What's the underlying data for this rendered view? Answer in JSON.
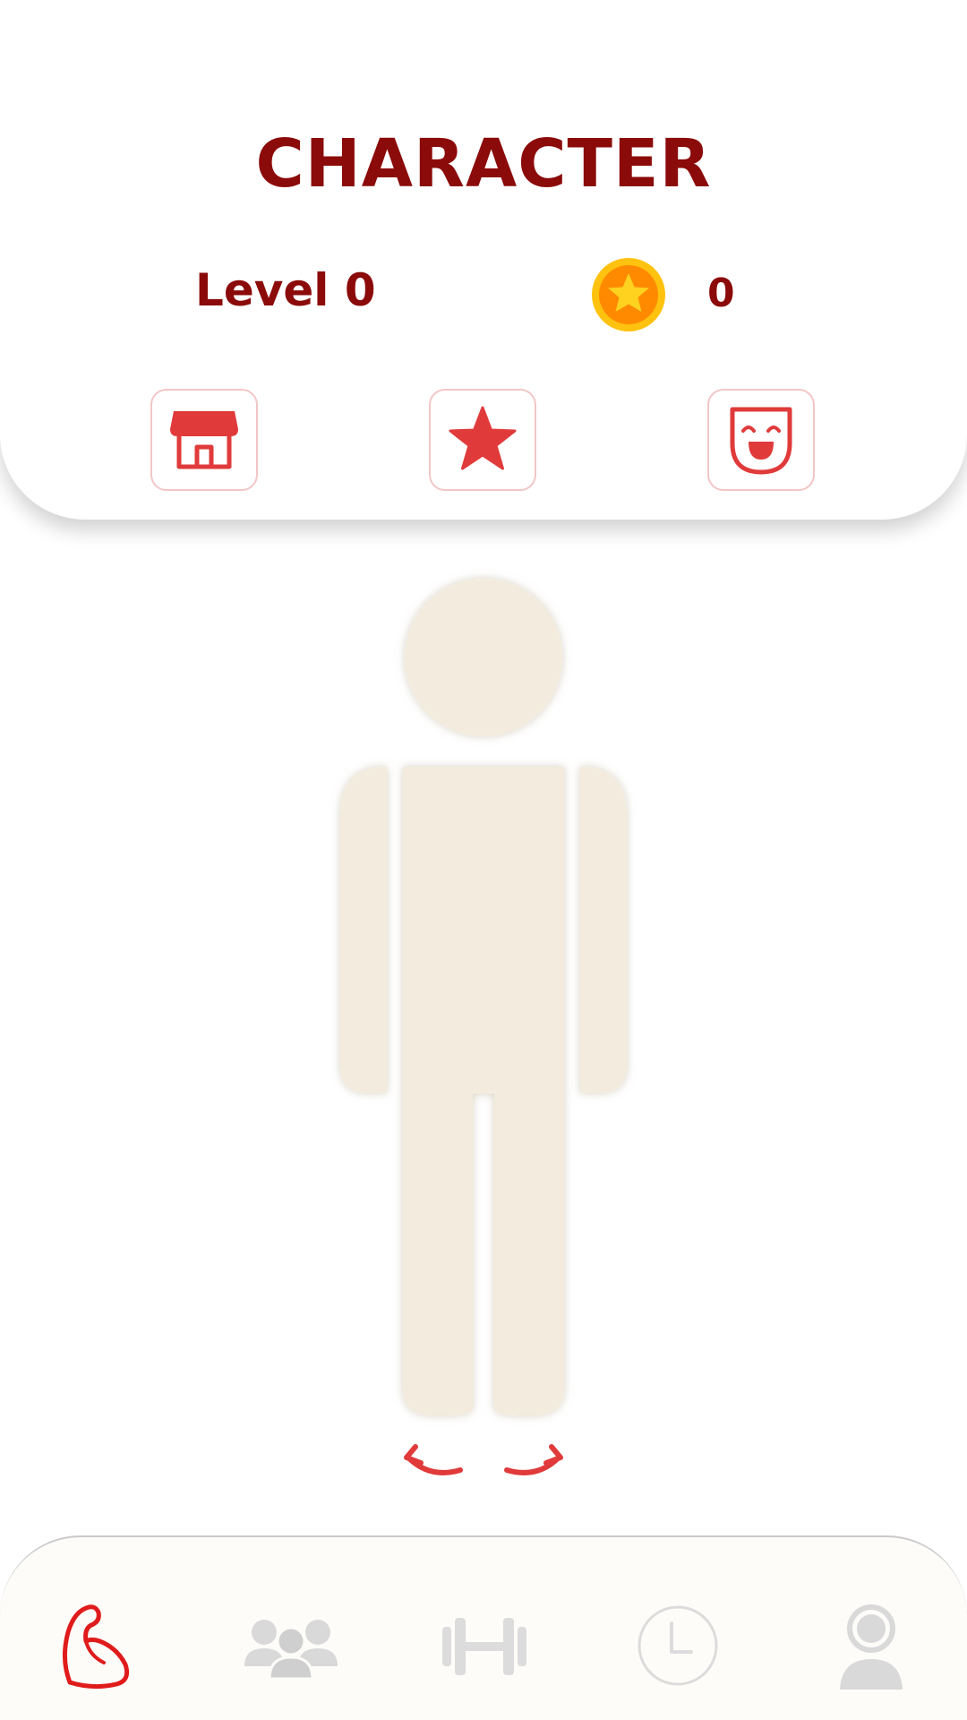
{
  "header": {
    "title": "CHARACTER",
    "level_text": "Level 0",
    "coin_count": "0",
    "coin_icon": "star-coin-icon"
  },
  "actions": [
    {
      "name": "shop",
      "icon": "store-icon"
    },
    {
      "name": "achievements",
      "icon": "star-icon"
    },
    {
      "name": "emotes",
      "icon": "smiley-face-icon"
    }
  ],
  "character": {
    "rotate_left_icon": "rotate-left-arrow-icon",
    "rotate_right_icon": "rotate-right-arrow-icon"
  },
  "bottom_nav": {
    "items": [
      {
        "name": "character",
        "icon": "flexed-arm-icon",
        "active": true
      },
      {
        "name": "friends",
        "icon": "group-icon",
        "active": false
      },
      {
        "name": "workout",
        "icon": "dumbbell-icon",
        "active": false
      },
      {
        "name": "history",
        "icon": "clock-icon",
        "active": false
      },
      {
        "name": "profile",
        "icon": "person-icon",
        "active": false
      }
    ]
  },
  "colors": {
    "accent": "#8b0a0a",
    "icon_red": "#e03a3a",
    "figure_fill": "#f3ebdd",
    "inactive_icon": "#d9d9d9"
  }
}
